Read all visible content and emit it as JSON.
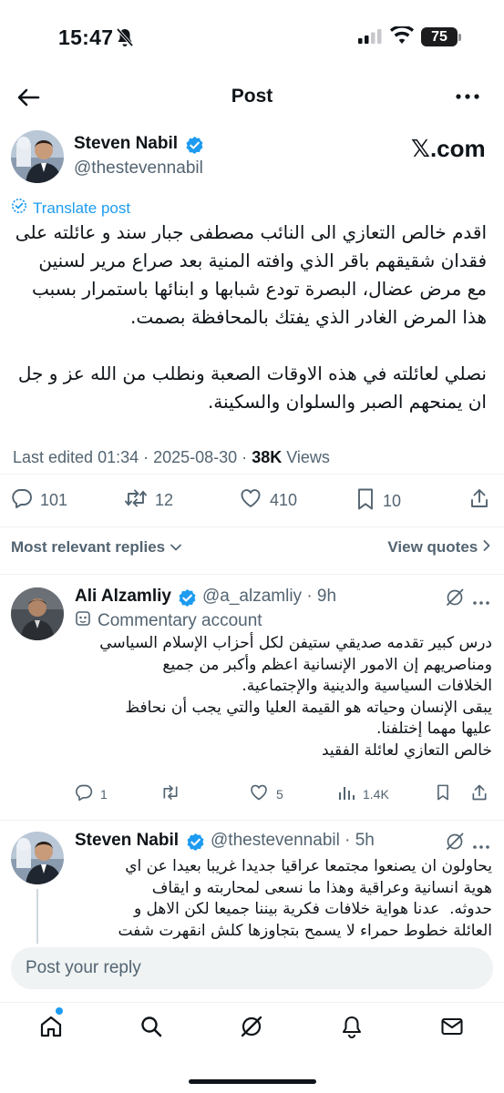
{
  "status_bar": {
    "time": "15:47",
    "battery": "75"
  },
  "header": {
    "title": "Post"
  },
  "post": {
    "author_name": "Steven Nabil",
    "author_handle": "@thestevennabil",
    "watermark": "𝕏.com",
    "translate_label": "Translate post",
    "text": "اقدم خالص التعازي الى النائب مصطفى جبار سند و عائلته على\nفقدان شقيقهم باقر الذي وافته المنية بعد صراع مرير لسنين\nمع مرض عضال، البصرة تودع شبابها و ابنائها باستمرار بسبب\nهذا المرض الغادر الذي يفتك بالمحافظة بصمت.\n\nنصلي لعائلته في هذه الاوقات الصعبة ونطلب من الله عز و جل\nان يمنحهم الصبر والسلوان والسكينة.",
    "edited": "Last edited 01:34 · 2025-08-30 · ",
    "views_count": "38K",
    "views_label": " Views",
    "stats": {
      "replies": "101",
      "reposts": "12",
      "likes": "410",
      "bookmarks": "10"
    }
  },
  "replies_bar": {
    "sort_label": "Most relevant replies",
    "view_quotes": "View quotes"
  },
  "replies": [
    {
      "name": "Ali Alzamliy",
      "handle": "@a_alzamliy · 9h",
      "badge": "Commentary account",
      "text": "درس كبير تقدمه صديقي ستيفن لكل أحزاب الإسلام السياسي\nومناصريهم إن الامور الإنسانية اعظم وأكبر من جميع\nالخلافات السياسية والدينية والإجتماعية.\nيبقى الإنسان وحياته هو القيمة العليا والتي يجب أن نحافظ\nعليها مهما إختلفنا.\nخالص التعازي لعائلة الفقيد",
      "stats": {
        "replies": "1",
        "reposts": "",
        "likes": "5",
        "views": "1.4K"
      }
    },
    {
      "name": "Steven Nabil",
      "handle": "@thestevennabil · 5h",
      "text": "يحاولون ان يصنعوا مجتمعا عراقيا جديدا غريبا بعيدا عن اي\nهوية انسانية وعراقية وهذا ما نسعى لمحاربته و ايقاف\nحدوثه.  عدنا هواية خلافات فكرية بيننا جميعا لكن الاهل و\nالعائلة خطوط حمراء لا يسمح بتجاوزها كلش انقهرت شفت"
    }
  ],
  "composer": {
    "placeholder": "Post your reply"
  },
  "colors": {
    "accent": "#1d9bf0",
    "text": "#0f1419",
    "secondary": "#536471"
  }
}
